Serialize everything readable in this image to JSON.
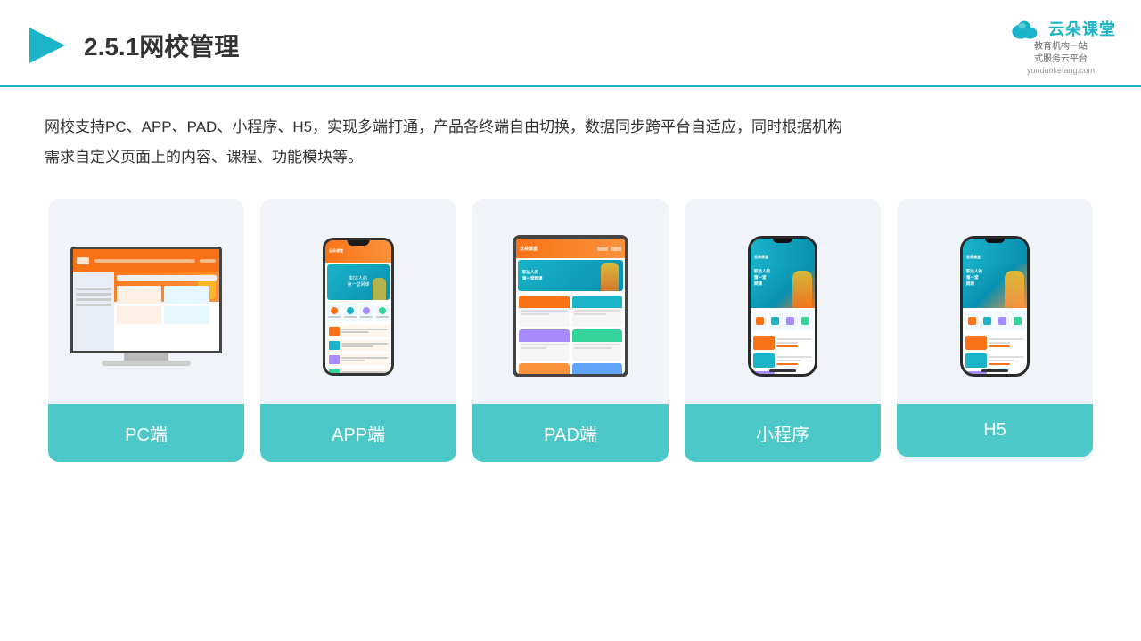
{
  "header": {
    "title": "2.5.1网校管理",
    "logo_name": "云朵课堂",
    "logo_url": "yunduoketang.com",
    "logo_tagline": "教育机构一站\n式服务云平台"
  },
  "description": "网校支持PC、APP、PAD、小程序、H5，实现多端打通，产品各终端自由切换，数据同步跨平台自适应，同时根据机构\n需求自定义页面上的内容、课程、功能模块等。",
  "cards": [
    {
      "id": "pc",
      "label": "PC端"
    },
    {
      "id": "app",
      "label": "APP端"
    },
    {
      "id": "pad",
      "label": "PAD端"
    },
    {
      "id": "miniprogram",
      "label": "小程序"
    },
    {
      "id": "h5",
      "label": "H5"
    }
  ],
  "colors": {
    "teal": "#4dc8c8",
    "accent": "#1ab3c8",
    "orange": "#f97316",
    "dark": "#333333",
    "border": "#1ab3c8"
  }
}
